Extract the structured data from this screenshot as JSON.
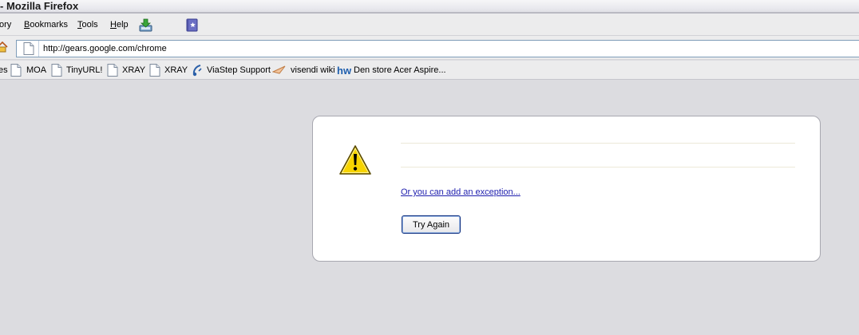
{
  "window": {
    "title": "- Mozilla Firefox"
  },
  "menu": {
    "items": [
      {
        "label": "ory",
        "underline": ""
      },
      {
        "label": "Bookmarks",
        "underline": "B"
      },
      {
        "label": "Tools",
        "underline": "T"
      },
      {
        "label": "Help",
        "underline": "H"
      }
    ],
    "icons": [
      "download-icon",
      "bookmark-book-icon"
    ]
  },
  "navbar": {
    "url": "http://gears.google.com/chrome"
  },
  "bookmarks": {
    "items": [
      {
        "label": "es",
        "icon": ""
      },
      {
        "label": "MOA",
        "icon": "page-icon"
      },
      {
        "label": "TinyURL!",
        "icon": "page-icon"
      },
      {
        "label": "XRAY",
        "icon": "page-icon"
      },
      {
        "label": "XRAY",
        "icon": "page-icon"
      },
      {
        "label": "ViaStep Support",
        "icon": "viastep-icon"
      },
      {
        "label": "visendi wiki",
        "icon": "visendi-icon"
      },
      {
        "label": "Den store Acer Aspire...",
        "icon": "hw-icon"
      }
    ]
  },
  "error_page": {
    "icon": "warning-icon",
    "link_text": "Or you can add an exception...",
    "button_label": "Try Again"
  },
  "colors": {
    "background": "#dcdce0",
    "link": "#1f1fae",
    "warning_yellow": "#f7d400",
    "button_border": "#0e2f80"
  }
}
